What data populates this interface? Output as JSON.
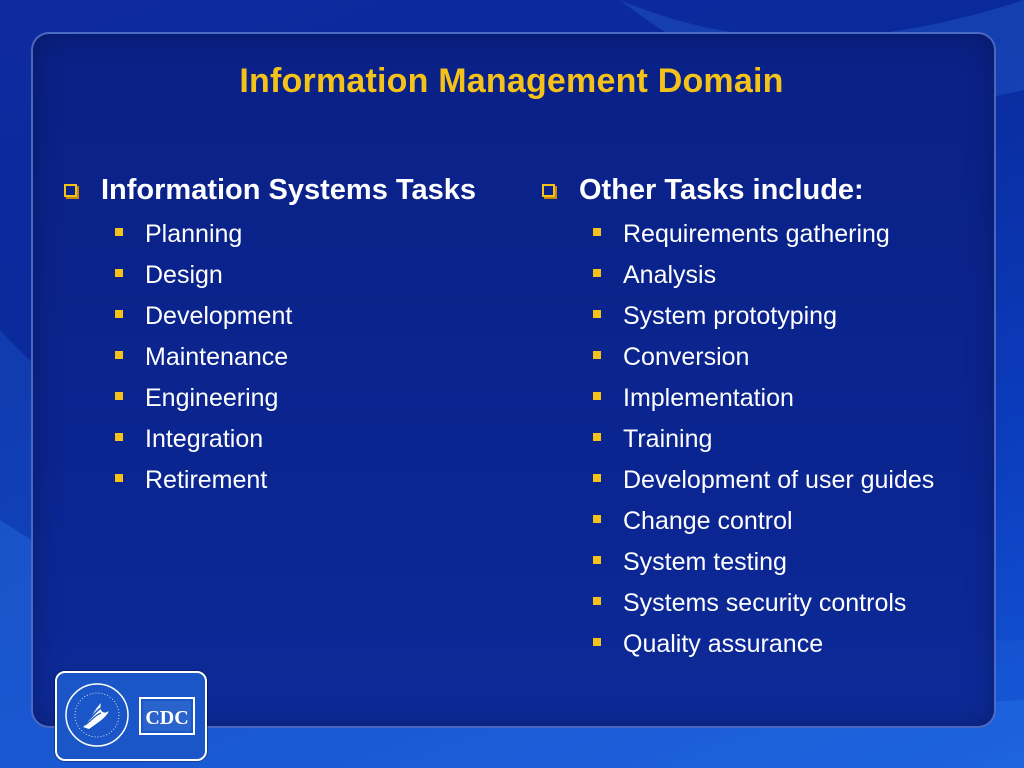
{
  "title": "Information Management Domain",
  "left_column": {
    "heading": "Information Systems Tasks",
    "items": [
      "Planning",
      "Design",
      "Development",
      "Maintenance",
      "Engineering",
      "Integration",
      "Retirement"
    ]
  },
  "right_column": {
    "heading": "Other Tasks include:",
    "items": [
      "Requirements gathering",
      "Analysis",
      "System prototyping",
      "Conversion",
      "Implementation",
      "Training",
      "Development of user guides",
      "Change control",
      "System testing",
      "Systems security controls",
      "Quality assurance"
    ]
  },
  "logo": {
    "cdc_text": "CDC",
    "seal_icon": "hhs-eagle-seal-icon"
  },
  "colors": {
    "title": "#f5c21a",
    "bullet": "#f5c21a",
    "text": "#ffffff",
    "background": "#0a2186"
  }
}
